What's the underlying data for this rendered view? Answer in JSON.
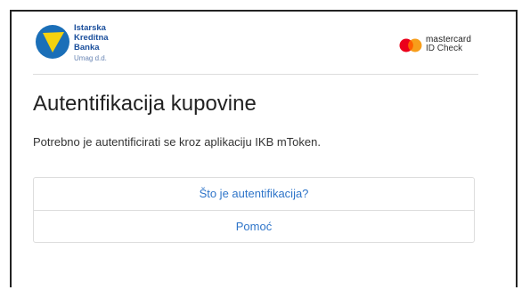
{
  "header": {
    "bank_name_lines": [
      "Istarska",
      "Kreditna",
      "Banka"
    ],
    "bank_location": "Umag d.d.",
    "card_brand": "mastercard",
    "card_program": "ID Check",
    "colors": {
      "bank_blue": "#1b4f9c",
      "bank_yellow": "#f5d20f",
      "mc_red": "#eb001b",
      "mc_yellow": "#f79e1b"
    }
  },
  "main": {
    "title": "Autentifikacija kupovine",
    "message": "Potrebno je autentificirati se kroz aplikaciju IKB mToken."
  },
  "links": [
    {
      "label": "Što je autentifikacija?"
    },
    {
      "label": "Pomoć"
    }
  ]
}
